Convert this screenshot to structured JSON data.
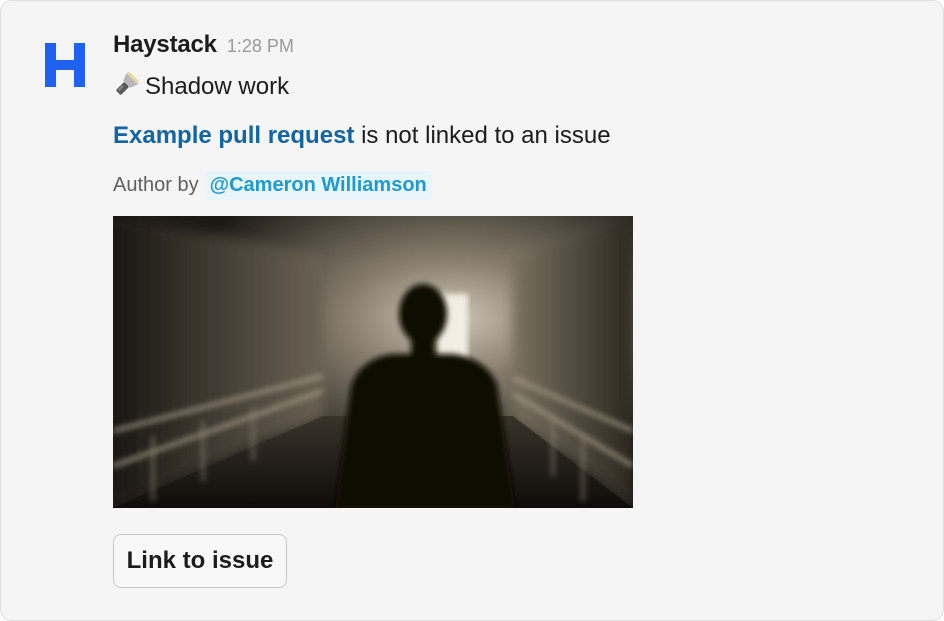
{
  "app": {
    "name": "Haystack",
    "logo_letter": "H",
    "brand_color": "#1f62f2"
  },
  "message": {
    "timestamp": "1:28 PM",
    "title_icon": "flashlight-icon",
    "title": "Shadow work",
    "pr_link_text": "Example pull request",
    "body_suffix": " is not linked to an issue",
    "author_label": "Author by",
    "author_mention": "@Cameron Williamson",
    "image_alt": "Silhouette of a person walking down a dim corridor"
  },
  "actions": {
    "link_issue_label": "Link to issue"
  },
  "colors": {
    "link": "#1264a3",
    "mention": "#1d9bd1",
    "mention_bg": "#e8f5fa",
    "card_bg": "#f4f5f4"
  }
}
